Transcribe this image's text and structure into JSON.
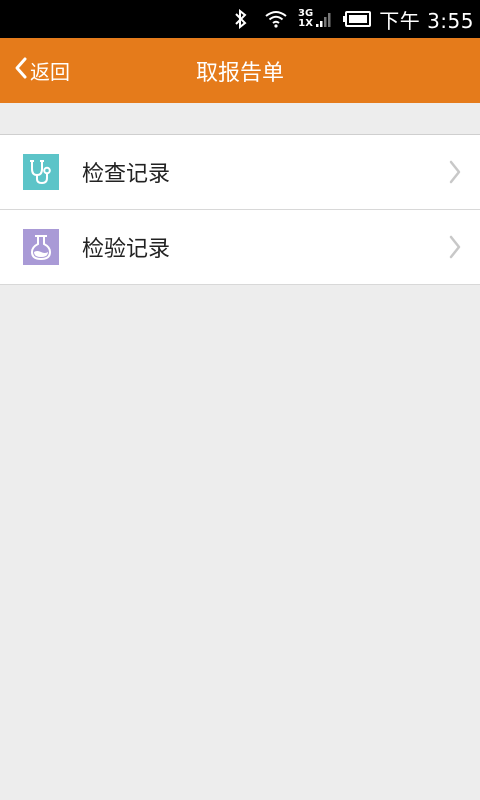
{
  "status_bar": {
    "network_top": "3G",
    "network_bottom": "1X",
    "time": "下午 3:55",
    "icons": [
      "bluetooth-icon",
      "wifi-icon",
      "signal-icon",
      "battery-icon"
    ]
  },
  "header": {
    "back_label": "返回",
    "title": "取报告单",
    "background": "#e57b1b"
  },
  "list": {
    "items": [
      {
        "label": "检查记录",
        "icon": "stethoscope-icon",
        "icon_color": "#5cc4c8"
      },
      {
        "label": "检验记录",
        "icon": "flask-icon",
        "icon_color": "#a99ad6"
      }
    ]
  }
}
